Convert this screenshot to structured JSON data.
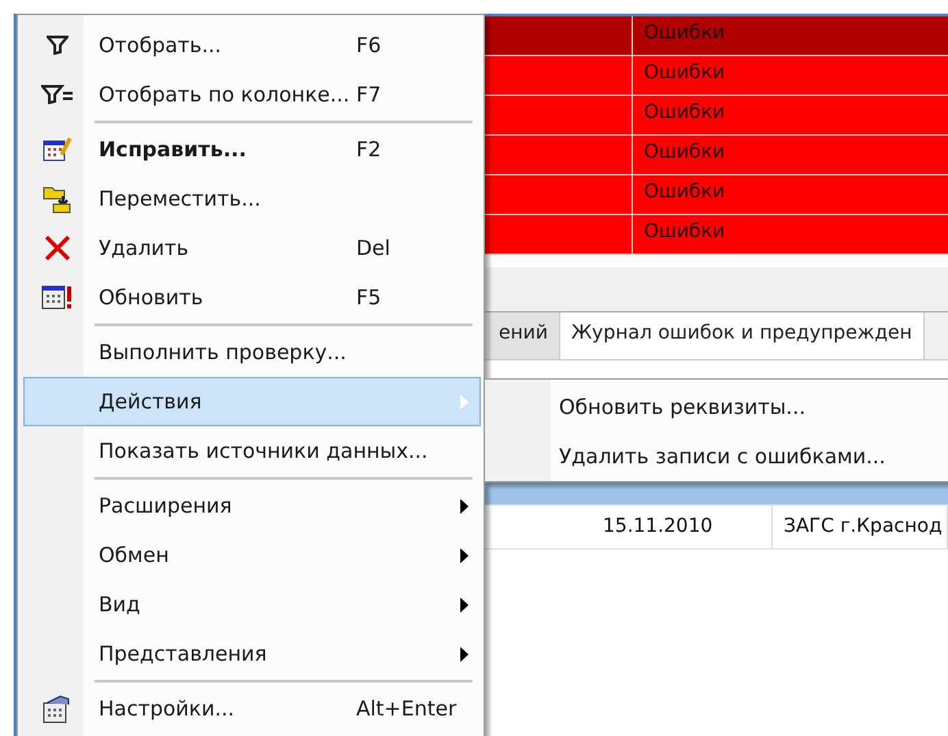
{
  "top_table": {
    "rows": [
      {
        "cell": "Ошибки",
        "selected": true
      },
      {
        "cell": "Ошибки",
        "selected": false
      },
      {
        "cell": "Ошибки",
        "selected": false
      },
      {
        "cell": "Ошибки",
        "selected": false
      },
      {
        "cell": "Ошибки",
        "selected": false
      },
      {
        "cell": "Ошибки",
        "selected": false
      }
    ]
  },
  "tabs": [
    {
      "label": "ений",
      "selected": false
    },
    {
      "label": "Журнал ошибок и предупрежден",
      "selected": true
    }
  ],
  "bottom_table": {
    "rows": [
      {
        "selected": true
      },
      {
        "date": "15.11.2010",
        "name": "ЗАГС г.Краснод",
        "selected": false
      }
    ]
  },
  "menu": {
    "items": [
      {
        "kind": "item",
        "label": "Отобрать...",
        "shortcut": "F6",
        "default": false,
        "selected": false,
        "submenu": false
      },
      {
        "kind": "item",
        "label": "Отобрать по колонке...",
        "shortcut": "F7",
        "default": false,
        "selected": false,
        "submenu": false
      },
      {
        "kind": "separator"
      },
      {
        "kind": "item",
        "label": "Исправить...",
        "shortcut": "F2",
        "default": true,
        "selected": false,
        "submenu": false
      },
      {
        "kind": "item",
        "label": "Переместить...",
        "default": false,
        "selected": false,
        "submenu": false
      },
      {
        "kind": "item",
        "label": "Удалить",
        "shortcut": "Del",
        "default": false,
        "selected": false,
        "submenu": false
      },
      {
        "kind": "item",
        "label": "Обновить",
        "shortcut": "F5",
        "default": false,
        "selected": false,
        "submenu": false
      },
      {
        "kind": "separator"
      },
      {
        "kind": "item",
        "label": "Выполнить проверку...",
        "default": false,
        "selected": false,
        "submenu": false
      },
      {
        "kind": "item",
        "label": "Действия",
        "default": false,
        "selected": true,
        "submenu": true
      },
      {
        "kind": "item",
        "label": "Показать источники данных...",
        "default": false,
        "selected": false,
        "submenu": false
      },
      {
        "kind": "separator"
      },
      {
        "kind": "item",
        "label": "Расширения",
        "default": false,
        "selected": false,
        "submenu": true
      },
      {
        "kind": "item",
        "label": "Обмен",
        "default": false,
        "selected": false,
        "submenu": true
      },
      {
        "kind": "item",
        "label": "Вид",
        "default": false,
        "selected": false,
        "submenu": true
      },
      {
        "kind": "item",
        "label": "Представления",
        "default": false,
        "selected": false,
        "submenu": true
      },
      {
        "kind": "separator"
      },
      {
        "kind": "item",
        "label": "Настройки...",
        "shortcut": "Alt+Enter",
        "default": false,
        "selected": false,
        "submenu": false
      }
    ]
  },
  "submenu": {
    "items": [
      {
        "label": "Обновить реквизиты..."
      },
      {
        "label": "Удалить записи с ошибками..."
      }
    ]
  }
}
